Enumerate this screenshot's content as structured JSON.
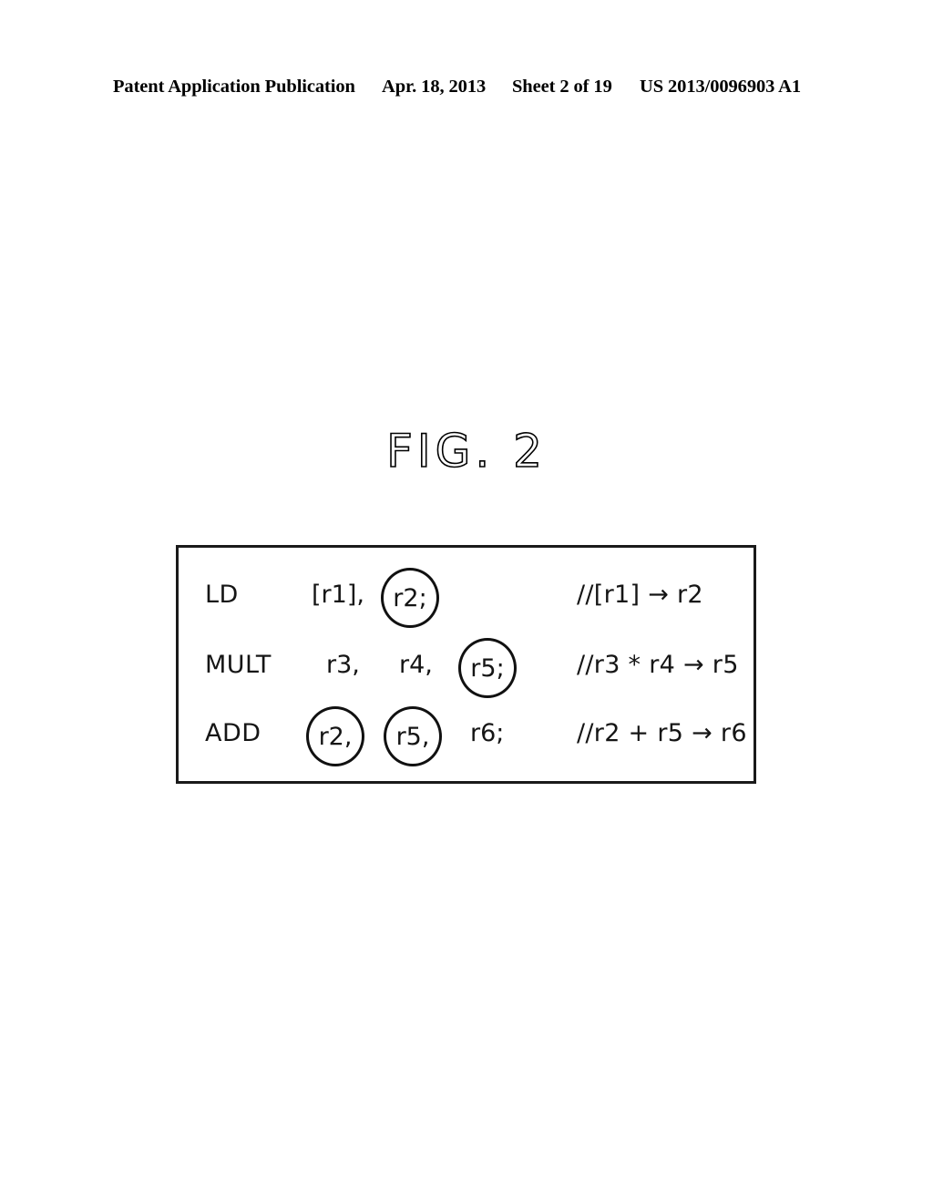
{
  "header": {
    "publication": "Patent Application Publication",
    "date": "Apr. 18, 2013",
    "sheet": "Sheet 2 of 19",
    "document_number": "US 2013/0096903 A1"
  },
  "figure": {
    "title": "FIG. 2"
  },
  "code_listing": {
    "rows": [
      {
        "mnemonic": "LD",
        "operands": [
          {
            "text": "[r1],",
            "circled": false
          },
          {
            "text": "r2;",
            "circled": true
          }
        ],
        "comment": "//[r1] → r2"
      },
      {
        "mnemonic": "MULT",
        "operands": [
          {
            "text": "r3,",
            "circled": false
          },
          {
            "text": "r4,",
            "circled": false
          },
          {
            "text": "r5;",
            "circled": true
          }
        ],
        "comment": "//r3 * r4 → r5"
      },
      {
        "mnemonic": "ADD",
        "operands": [
          {
            "text": "r2,",
            "circled": true
          },
          {
            "text": "r5,",
            "circled": true
          },
          {
            "text": "r6;",
            "circled": false
          }
        ],
        "comment": "//r2 + r5 → r6"
      }
    ]
  },
  "colors": {
    "ink": "#151515",
    "border": "#1a1a1a",
    "background": "#ffffff"
  }
}
